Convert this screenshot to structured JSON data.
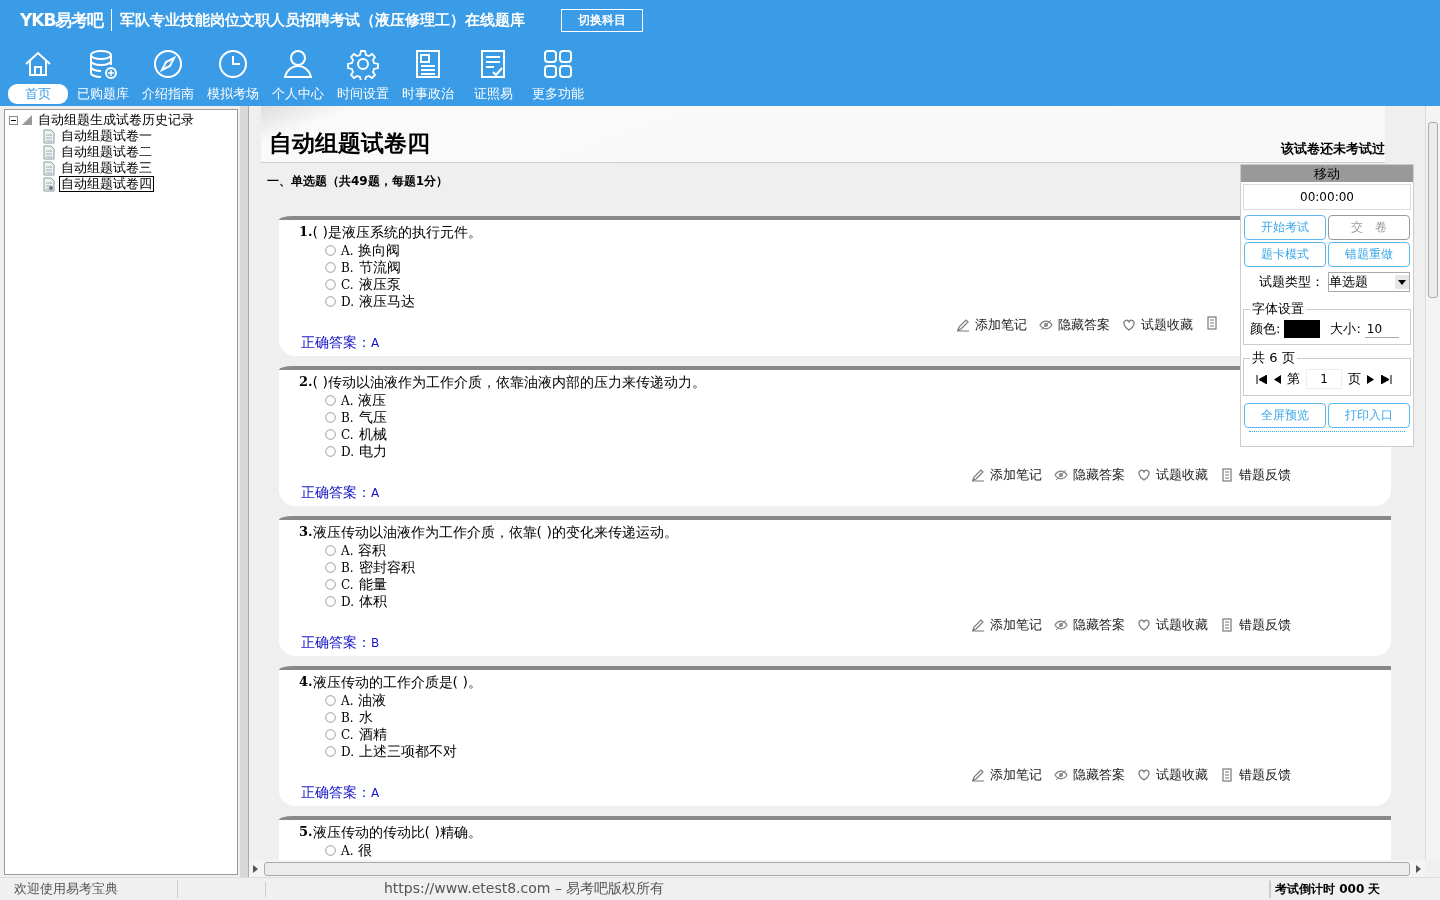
{
  "header": {
    "logo": "YKB易考吧",
    "title": "军队专业技能岗位文职人员招聘考试（液压修理工）在线题库",
    "switch_button": "切换科目",
    "nav": [
      {
        "label": "首页",
        "selected": true
      },
      {
        "label": "已购题库",
        "selected": false
      },
      {
        "label": "介绍指南",
        "selected": false
      },
      {
        "label": "模拟考场",
        "selected": false
      },
      {
        "label": "个人中心",
        "selected": false
      },
      {
        "label": "时间设置",
        "selected": false
      },
      {
        "label": "时事政治",
        "selected": false
      },
      {
        "label": "证照易",
        "selected": false
      },
      {
        "label": "更多功能",
        "selected": false
      }
    ]
  },
  "tree": {
    "label": "自动组题生成试卷历史记录",
    "expanded": true,
    "children": [
      {
        "label": "自动组题试卷一",
        "selected": false
      },
      {
        "label": "自动组题试卷二",
        "selected": false
      },
      {
        "label": "自动组题试卷三",
        "selected": false
      },
      {
        "label": "自动组题试卷四",
        "selected": true
      }
    ]
  },
  "paper": {
    "title": "自动组题试卷四",
    "status": "该试卷还未考试过",
    "section": "一、单选题（共49题，每题1分）"
  },
  "questions": [
    {
      "number": "1.",
      "text": "( )是液压系统的执行元件。",
      "options": [
        {
          "letter": "A.",
          "text": "换向阀",
          "selected": false
        },
        {
          "letter": "B.",
          "text": "节流阀",
          "selected": false
        },
        {
          "letter": "C.",
          "text": "液压泵",
          "selected": false
        },
        {
          "letter": "D.",
          "text": "液压马达",
          "selected": false
        }
      ],
      "answer_label": "正确答案：",
      "answer": "A",
      "actions": [
        "添加笔记",
        "隐藏答案",
        "试题收藏"
      ]
    },
    {
      "number": "2.",
      "text": "( )传动以油液作为工作介质，依靠油液内部的压力来传递动力。",
      "options": [
        {
          "letter": "A.",
          "text": "液压",
          "selected": false
        },
        {
          "letter": "B.",
          "text": "气压",
          "selected": false
        },
        {
          "letter": "C.",
          "text": "机械",
          "selected": false
        },
        {
          "letter": "D.",
          "text": "电力",
          "selected": false
        }
      ],
      "answer_label": "正确答案：",
      "answer": "A",
      "actions": [
        "添加笔记",
        "隐藏答案",
        "试题收藏",
        "错题反馈"
      ]
    },
    {
      "number": "3.",
      "text": "液压传动以油液作为工作介质，依靠( )的变化来传递运动。",
      "options": [
        {
          "letter": "A.",
          "text": "容积",
          "selected": false
        },
        {
          "letter": "B.",
          "text": "密封容积",
          "selected": false
        },
        {
          "letter": "C.",
          "text": "能量",
          "selected": false
        },
        {
          "letter": "D.",
          "text": "体积",
          "selected": false
        }
      ],
      "answer_label": "正确答案：",
      "answer": "B",
      "actions": [
        "添加笔记",
        "隐藏答案",
        "试题收藏",
        "错题反馈"
      ]
    },
    {
      "number": "4.",
      "text": "液压传动的工作介质是( )。",
      "options": [
        {
          "letter": "A.",
          "text": "油液",
          "selected": false
        },
        {
          "letter": "B.",
          "text": "水",
          "selected": false
        },
        {
          "letter": "C.",
          "text": "酒精",
          "selected": false
        },
        {
          "letter": "D.",
          "text": "上述三项都不对",
          "selected": false
        }
      ],
      "answer_label": "正确答案：",
      "answer": "A",
      "actions": [
        "添加笔记",
        "隐藏答案",
        "试题收藏",
        "错题反馈"
      ]
    },
    {
      "number": "5.",
      "text": "液压传动的传动比( )精确。",
      "options": [
        {
          "letter": "A.",
          "text": "很",
          "selected": false
        }
      ]
    }
  ],
  "panel": {
    "header": "移动",
    "timer": "00:00:00",
    "buttons": [
      {
        "label": "开始考试",
        "disabled": false
      },
      {
        "label": "交　卷",
        "disabled": true
      },
      {
        "label": "题卡模式",
        "disabled": false
      },
      {
        "label": "错题重做",
        "disabled": false
      }
    ],
    "type_label": "试题类型：",
    "type_value": "单选题",
    "font_legend": "字体设置",
    "color_label": "颜色:",
    "color": "#000000",
    "size_label": "大小:",
    "size": "10",
    "pages_legend": "共 6 页",
    "page_prefix": "第",
    "page": "1",
    "page_suffix": "页",
    "bottom_buttons": [
      "全屏预览",
      "打印入口"
    ]
  },
  "status_bar": {
    "left": "欢迎使用易考宝典",
    "center": "https://www.etest8.com – 易考吧版权所有",
    "right": "考试倒计时 000 天"
  }
}
